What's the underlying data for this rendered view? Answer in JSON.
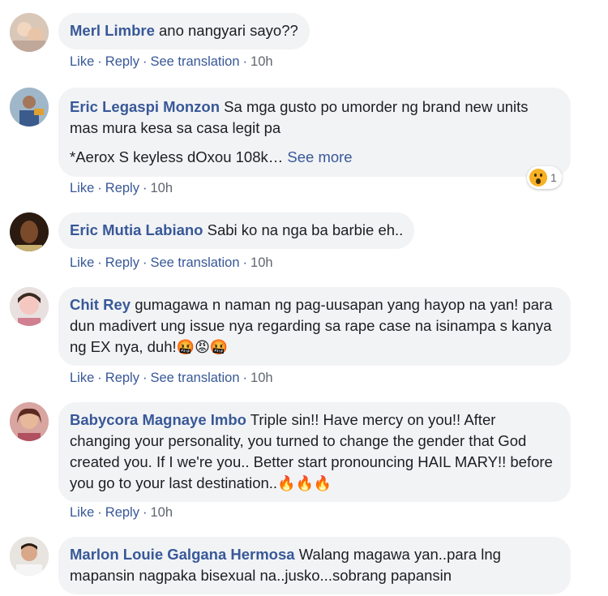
{
  "colors": {
    "link": "#385898",
    "bubble": "#f2f3f5",
    "meta": "#606770"
  },
  "actions": {
    "like": "Like",
    "reply": "Reply",
    "translate": "See translation"
  },
  "comments": [
    {
      "author": "Merl Limbre",
      "text": "ano nangyari sayo??",
      "time": "10h",
      "has_translation": true
    },
    {
      "author": "Eric Legaspi Monzon",
      "text": "Sa mga gusto po umorder ng brand new units mas mura kesa sa casa legit pa",
      "text2": "*Aerox S keyless dOxou 108k…",
      "see_more": "See more",
      "time": "10h",
      "has_translation": false,
      "reaction_count": "1",
      "reaction_icon": "wow-icon"
    },
    {
      "author": "Eric Mutia Labiano",
      "text": "Sabi ko na nga ba barbie eh..",
      "time": "10h",
      "has_translation": true
    },
    {
      "author": "Chit Rey",
      "text": "gumagawa n naman ng pag-uusapan yang hayop na yan! para dun madivert ung issue nya regarding sa rape case na isinampa s kanya ng EX nya, duh!",
      "emojis": "🤬😡🤬",
      "time": "10h",
      "has_translation": true
    },
    {
      "author": "Babycora Magnaye Imbo",
      "text": "Triple sin!! Have mercy on you!! After changing your personality, you turned to change the gender that God created you. If I we're you.. Better start pronouncing HAIL MARY!! before you go to your last destination..",
      "emojis": "🔥🔥🔥",
      "time": "10h",
      "has_translation": false
    },
    {
      "author": "Marlon Louie Galgana Hermosa",
      "text": "Walang magawa yan..para lng mapansin nagpaka bisexual na..jusko...sobrang papansin"
    }
  ]
}
